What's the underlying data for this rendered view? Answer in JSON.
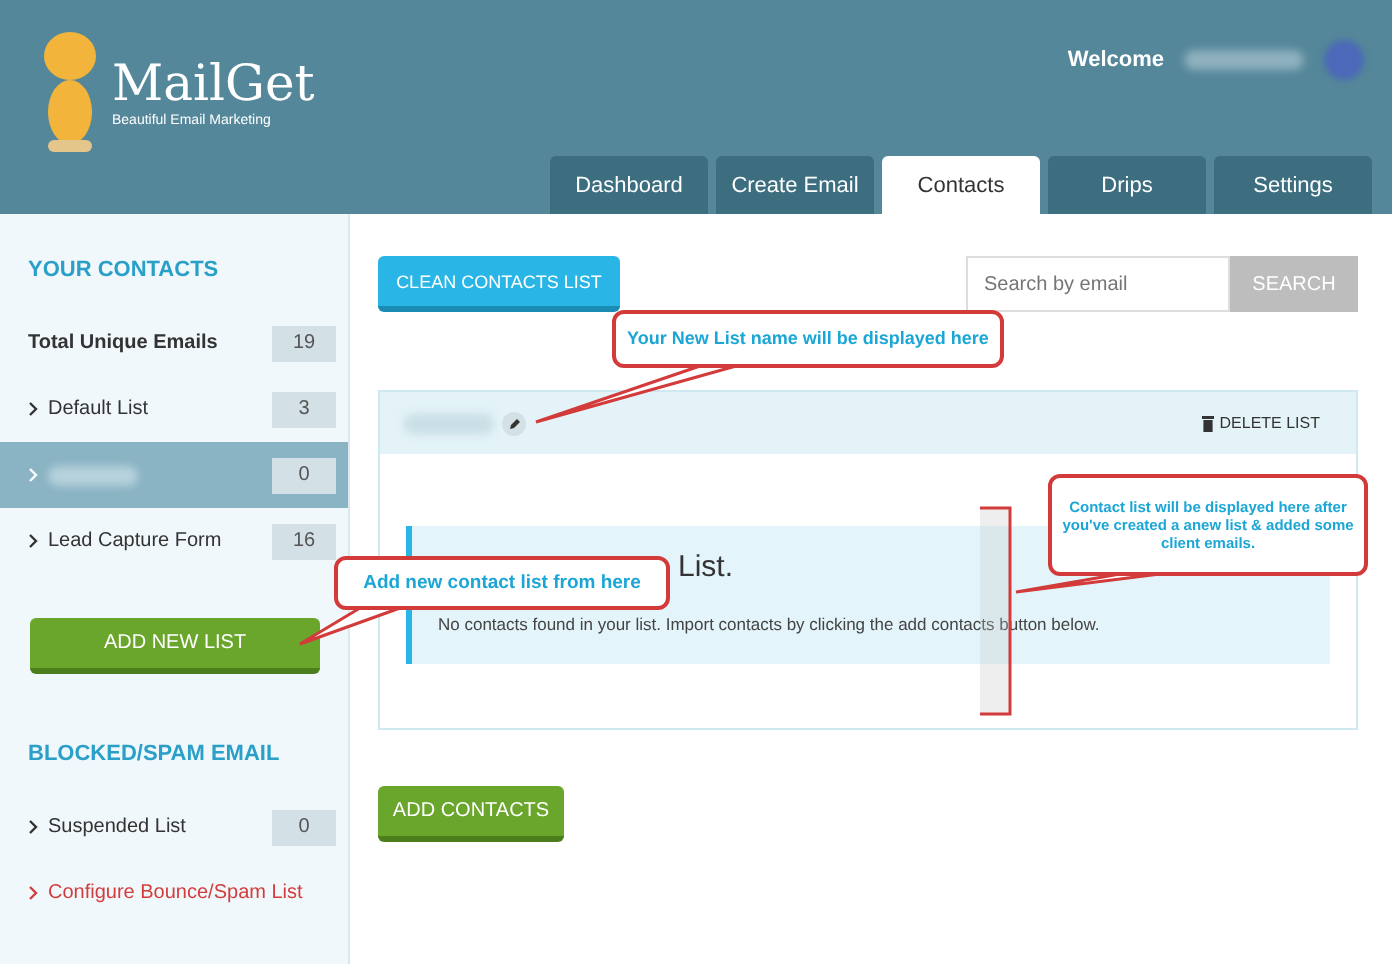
{
  "header": {
    "logo": "MailGet",
    "tagline": "Beautiful Email Marketing",
    "welcome": "Welcome"
  },
  "tabs": [
    {
      "label": "Dashboard",
      "selected": false
    },
    {
      "label": "Create Email",
      "selected": false
    },
    {
      "label": "Contacts",
      "selected": true
    },
    {
      "label": "Drips",
      "selected": false
    },
    {
      "label": "Settings",
      "selected": false
    }
  ],
  "sidebar": {
    "contacts_heading": "YOUR CONTACTS",
    "items": [
      {
        "kind": "total",
        "label": "Total Unique Emails",
        "count": "19",
        "selected": false
      },
      {
        "kind": "list",
        "label": "Default List",
        "count": "3",
        "selected": false
      },
      {
        "kind": "list",
        "count": "0",
        "selected": true
      },
      {
        "kind": "list",
        "label": "Lead Capture Form",
        "count": "16",
        "selected": false
      }
    ],
    "add_button": "ADD NEW LIST",
    "blocked_heading": "BLOCKED/SPAM EMAIL",
    "blocked_items": [
      {
        "kind": "list",
        "label": "Suspended List",
        "count": "0"
      },
      {
        "kind": "link",
        "label": "Configure Bounce/Spam List"
      }
    ]
  },
  "main": {
    "clean_button": "CLEAN CONTACTS LIST",
    "search": {
      "placeholder": "Search by email",
      "button": "SEARCH"
    },
    "delete_button": "DELETE LIST",
    "empty_title": "List.",
    "empty_text": "No contacts found in your list. Import contacts by clicking the add contacts button below.",
    "add_contacts_button": "ADD CONTACTS"
  },
  "callouts": [
    "Your New List name will be displayed here",
    "Add new contact list from here",
    "Contact list will be displayed here after you've created a anew list & added some client emails."
  ]
}
